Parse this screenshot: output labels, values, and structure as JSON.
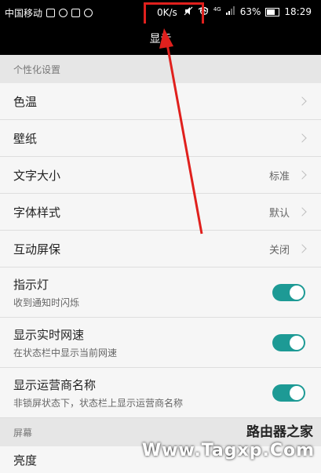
{
  "status_bar": {
    "carrier": "中国移动",
    "net_speed": "0K/s",
    "signal_label": "4G",
    "battery_percent": "63%",
    "battery_level": 0.63,
    "time": "18:29",
    "icons": [
      "sim-icon",
      "message-icon",
      "chat-icon",
      "app-icon",
      "mute-icon",
      "alarm-icon",
      "wifi-icon",
      "signal-icon",
      "battery-icon"
    ]
  },
  "header": {
    "title": "显示"
  },
  "sections": {
    "personalization": "个性化设置",
    "screen": "屏幕"
  },
  "rows": {
    "color_temp": {
      "label": "色温"
    },
    "wallpaper": {
      "label": "壁纸"
    },
    "text_size": {
      "label": "文字大小",
      "value": "标准"
    },
    "font_style": {
      "label": "字体样式",
      "value": "默认"
    },
    "screensaver": {
      "label": "互动屏保",
      "value": "关闭"
    },
    "indicator": {
      "label": "指示灯",
      "sub": "收到通知时闪烁",
      "enabled": true
    },
    "net_speed": {
      "label": "显示实时网速",
      "sub": "在状态栏中显示当前网速",
      "enabled": true
    },
    "carrier_name": {
      "label": "显示运营商名称",
      "sub": "非锁屏状态下，状态栏上显示运营商名称",
      "enabled": true
    },
    "brightness": {
      "label": "亮度"
    }
  },
  "watermark": {
    "line1": "路由器之家",
    "line2": "Www.Tagxp.Com"
  },
  "colors": {
    "accent": "#1d9a95",
    "highlight": "#e0201d",
    "background": "#ececec"
  }
}
